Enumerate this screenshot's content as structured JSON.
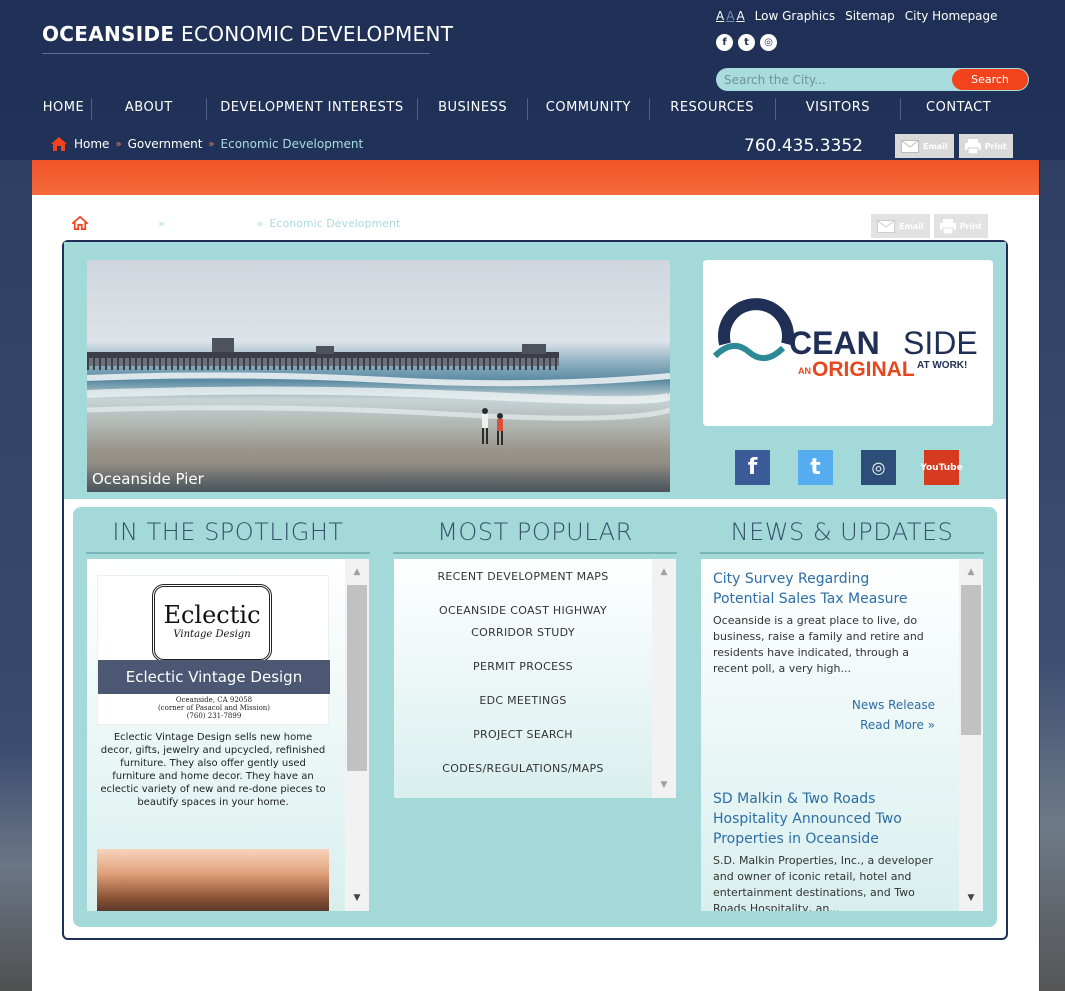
{
  "header": {
    "title_bold": "OCEANSIDE",
    "title_rest": "ECONOMIC DEVELOPMENT",
    "text_size_labels": [
      "A",
      "A",
      "A"
    ],
    "top_links": [
      "Low Graphics",
      "Sitemap",
      "City Homepage"
    ],
    "social_icons": [
      "facebook-icon",
      "twitter-icon",
      "instagram-icon"
    ],
    "search": {
      "placeholder": "Search the City...",
      "button_label": "Search"
    },
    "phone": "760.435.3352",
    "email_label": "Email",
    "print_label": "Print"
  },
  "nav": {
    "items": [
      {
        "label": "HOME",
        "w": 56
      },
      {
        "label": "ABOUT",
        "w": 115
      },
      {
        "label": "DEVELOPMENT INTERESTS",
        "w": 212
      },
      {
        "label": "BUSINESS",
        "w": 110
      },
      {
        "label": "COMMUNITY",
        "w": 122
      },
      {
        "label": "RESOURCES",
        "w": 126
      },
      {
        "label": "VISITORS",
        "w": 126
      },
      {
        "label": "CONTACT",
        "w": 115
      }
    ]
  },
  "breadcrumb": {
    "items": [
      "Home",
      "Government",
      "Economic Development"
    ],
    "separator": "»"
  },
  "inner_breadcrumb": {
    "current": "Economic Development",
    "separator": "»"
  },
  "hero": {
    "caption": "Oceanside Pier",
    "logo_word_1": "CEAN",
    "logo_word_2": "SIDE",
    "logo_an": "AN",
    "logo_original": "ORIGINAL",
    "logo_at_work": "AT WORK!",
    "social": [
      {
        "name": "facebook-icon",
        "glyph": "f"
      },
      {
        "name": "twitter-icon",
        "glyph": "t"
      },
      {
        "name": "instagram-icon",
        "glyph": "◎"
      },
      {
        "name": "youtube-icon",
        "glyph": "You Tube"
      }
    ]
  },
  "colors": {
    "navy": "#1f2f55",
    "accent_orange": "#f2431c",
    "teal": "#a3d9d8",
    "link_blue": "#2c6ea5"
  },
  "spotlight": {
    "heading": "IN THE SPOTLIGHT",
    "frame_big": "Eclectic",
    "frame_small": "Vintage Design",
    "banner": "Eclectic Vintage Design",
    "address_1": "Oceanside, CA 92058",
    "address_2": "(corner of Pasacol and Mission)",
    "address_3": "(760) 231-7899",
    "description": "Eclectic Vintage Design sells new home decor, gifts, jewelry and upcycled, refinished furniture. They also offer gently used furniture and home decor. They have an eclectic variety of new and re-done pieces to beautify spaces in your home."
  },
  "popular": {
    "heading": "MOST POPULAR",
    "items": [
      "RECENT DEVELOPMENT MAPS",
      "OCEANSIDE COAST HIGHWAY CORRIDOR STUDY",
      "PERMIT PROCESS",
      "EDC MEETINGS",
      "PROJECT SEARCH",
      "CODES/REGULATIONS/MAPS"
    ]
  },
  "news": {
    "heading": "NEWS & UPDATES",
    "items": [
      {
        "title": "City Survey Regarding Potential Sales Tax Measure",
        "body": "Oceanside is a great place to live, do business, raise a family and retire and residents have indicated, through a recent poll, a very high...",
        "category": "News Release",
        "read_more": "Read More »"
      },
      {
        "title": "SD Malkin & Two Roads Hospitality Announced Two Properties in Oceanside",
        "body": "S.D. Malkin Properties, Inc., a developer and owner of iconic retail, hotel and entertainment destinations, and Two Roads Hospitality, an..."
      }
    ]
  }
}
